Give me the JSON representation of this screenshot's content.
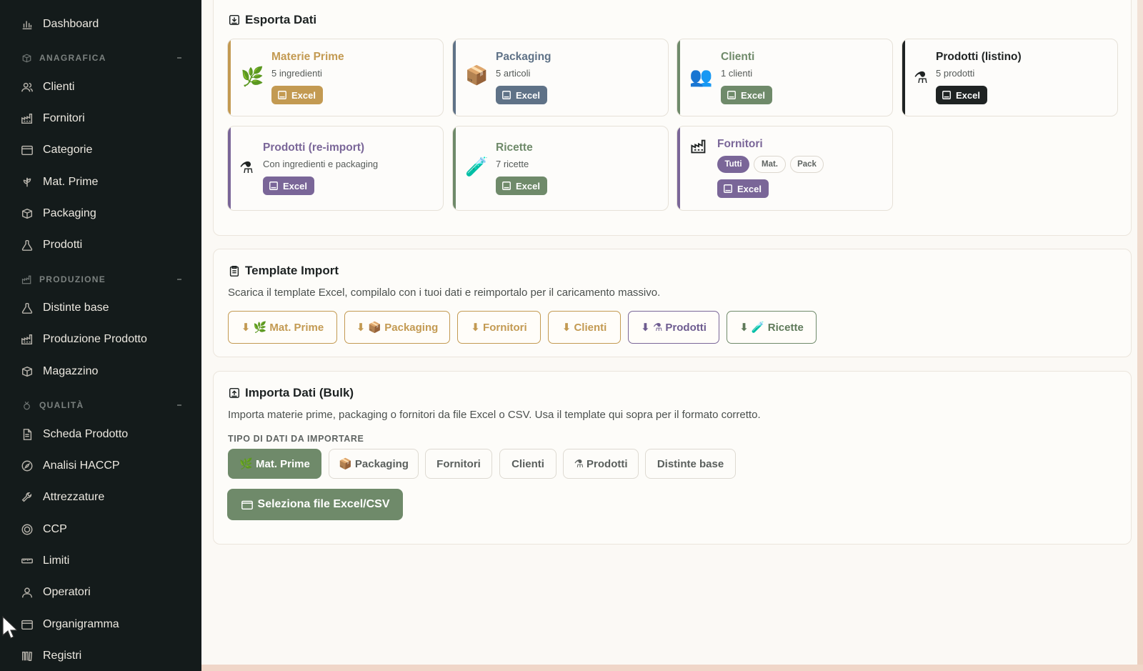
{
  "sidebar": {
    "items": [
      {
        "label": "Dashboard",
        "icon": "bar-chart-icon"
      },
      {
        "label": "Clienti",
        "icon": "users-icon"
      },
      {
        "label": "Fornitori",
        "icon": "factory-icon"
      },
      {
        "label": "Categorie",
        "icon": "folder-icon"
      },
      {
        "label": "Mat. Prime",
        "icon": "leaf-icon"
      },
      {
        "label": "Packaging",
        "icon": "box-icon"
      },
      {
        "label": "Prodotti",
        "icon": "flask-icon"
      },
      {
        "label": "Distinte base",
        "icon": "flask-icon"
      },
      {
        "label": "Produzione Prodotto",
        "icon": "factory-icon"
      },
      {
        "label": "Magazzino",
        "icon": "box-icon"
      },
      {
        "label": "Scheda Prodotto",
        "icon": "document-icon"
      },
      {
        "label": "Analisi HACCP",
        "icon": "compass-icon"
      },
      {
        "label": "Attrezzature",
        "icon": "wrench-icon"
      },
      {
        "label": "CCP",
        "icon": "target-icon"
      },
      {
        "label": "Limiti",
        "icon": "ruler-icon"
      },
      {
        "label": "Operatori",
        "icon": "user-icon"
      },
      {
        "label": "Organigramma",
        "icon": "folder-icon"
      },
      {
        "label": "Registri",
        "icon": "books-icon"
      }
    ],
    "sections": {
      "anagrafica": "ANAGRAFICA",
      "produzione": "PRODUZIONE",
      "qualita": "QUALITÀ"
    }
  },
  "export": {
    "title": "Esporta Dati",
    "excel_label": "Excel",
    "cards": [
      {
        "title": "Materie Prime",
        "sub": "5 ingredienti",
        "emoji": "🌿",
        "color": "#c39a52"
      },
      {
        "title": "Packaging",
        "sub": "5 articoli",
        "emoji": "📦",
        "color": "#5f7287"
      },
      {
        "title": "Clienti",
        "sub": "1 clienti",
        "emoji": "👥",
        "color": "#6f8a6a"
      },
      {
        "title": "Prodotti (listino)",
        "sub": "5 prodotti",
        "emoji": "⚗",
        "color": "#1f2323"
      },
      {
        "title": "Prodotti (re-import)",
        "sub": "Con ingredienti e packaging",
        "emoji": "⚗",
        "color": "#7a6698"
      },
      {
        "title": "Ricette",
        "sub": "7 ricette",
        "emoji": "🧪",
        "color": "#6f8a6a"
      },
      {
        "title": "Fornitori",
        "sub": "",
        "emoji": "🏭",
        "color": "#7a6698"
      }
    ],
    "fornitori_chips": [
      "Tutti",
      "Mat.",
      "Pack"
    ]
  },
  "template": {
    "title": "Template Import",
    "desc": "Scarica il template Excel, compilalo con i tuoi dati e reimportalo per il caricamento massivo.",
    "buttons": [
      {
        "label": "⬇ 🌿 Mat. Prime",
        "color": "#c39a52"
      },
      {
        "label": "⬇ 📦 Packaging",
        "color": "#c39a52"
      },
      {
        "label": "⬇ Fornitori",
        "color": "#c39a52"
      },
      {
        "label": "⬇ Clienti",
        "color": "#c39a52"
      },
      {
        "label": "⬇ ⚗ Prodotti",
        "color": "#6e5c90"
      },
      {
        "label": "⬇ 🧪 Ricette",
        "color": "#5f7a5a"
      }
    ]
  },
  "import": {
    "title": "Importa Dati (Bulk)",
    "desc": "Importa materie prime, packaging o fornitori da file Excel o CSV. Usa il template qui sopra per il formato corretto.",
    "type_label": "TIPO DI DATI DA IMPORTARE",
    "types": [
      "🌿 Mat. Prime",
      "📦 Packaging",
      "Fornitori",
      "Clienti",
      "⚗ Prodotti",
      "Distinte base"
    ],
    "selected_type": "🌿 Mat. Prime",
    "select_file_label": "Seleziona file Excel/CSV"
  }
}
